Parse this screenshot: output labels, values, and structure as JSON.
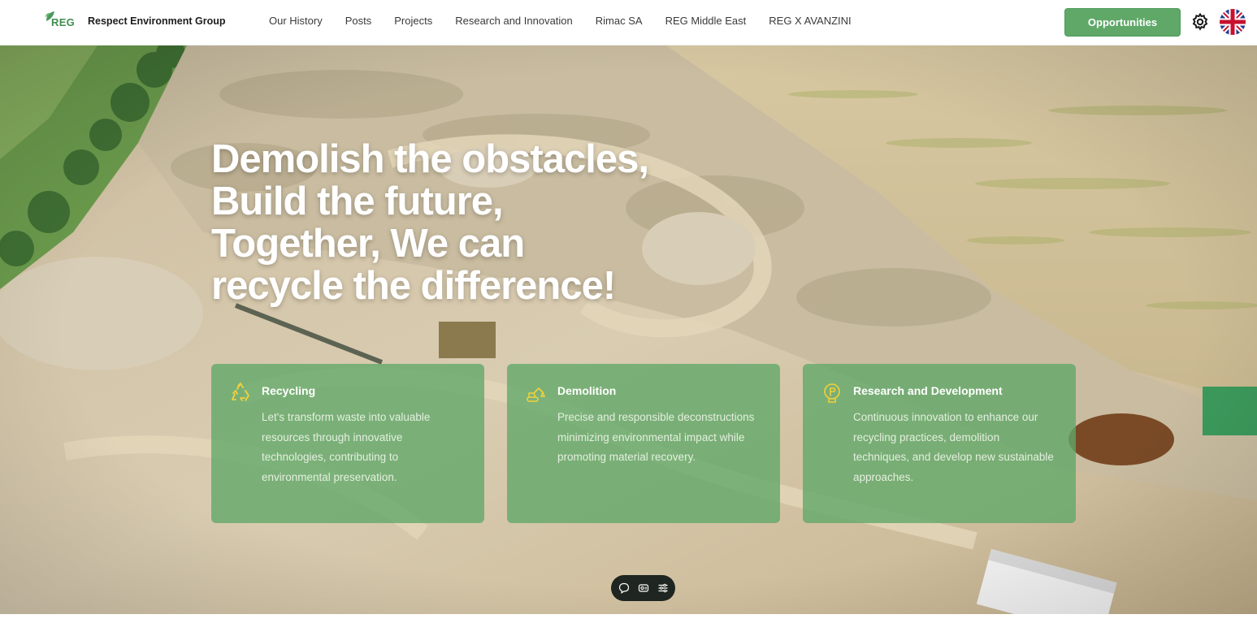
{
  "brand": {
    "logo_text": "REG",
    "name": "Respect Environment Group",
    "logo_color": "#3f8f4f"
  },
  "nav": {
    "items": [
      {
        "label": "Our History"
      },
      {
        "label": "Posts"
      },
      {
        "label": "Projects"
      },
      {
        "label": "Research and Innovation"
      },
      {
        "label": "Rimac SA"
      },
      {
        "label": "REG Middle East"
      },
      {
        "label": "REG X AVANZINI"
      }
    ]
  },
  "header": {
    "cta_label": "Opportunities",
    "settings_icon": "gear-icon",
    "language_icon": "uk-flag-icon"
  },
  "hero": {
    "title_lines": [
      "Demolish the obstacles,",
      "Build the future,",
      "Together, We can",
      "recycle the difference!"
    ]
  },
  "cards": [
    {
      "icon": "recycle-icon",
      "title": "Recycling",
      "description": "Let's transform waste into valuable resources through innovative technologies, contributing to environmental preservation."
    },
    {
      "icon": "excavator-icon",
      "title": "Demolition",
      "description": "Precise and responsible deconstructions minimizing environmental impact while promoting material recovery."
    },
    {
      "icon": "lightbulb-icon",
      "title": "Research and Development",
      "description": "Continuous innovation to enhance our recycling practices, demolition techniques, and develop new sustainable approaches."
    }
  ],
  "widget": {
    "icons": [
      "chat-icon",
      "card-icon",
      "menu-icon"
    ]
  },
  "colors": {
    "accent_green": "#5fa868",
    "card_icon_yellow": "#f2d13a",
    "widget_bg": "#1f2521"
  }
}
